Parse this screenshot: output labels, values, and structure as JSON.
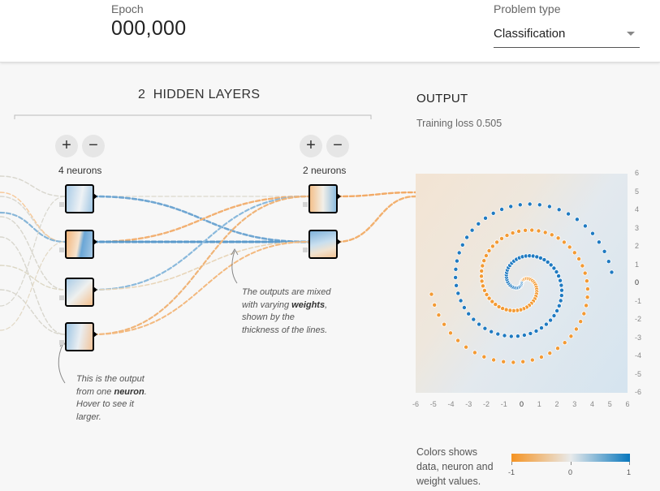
{
  "header": {
    "epoch_label": "Epoch",
    "epoch_value": "000,000",
    "problem_type_label": "Problem type",
    "problem_type_value": "Classification"
  },
  "layers": {
    "count": "2",
    "title": "HIDDEN LAYERS",
    "columns": [
      {
        "add": "+",
        "remove": "−",
        "neurons_label": "4 neurons"
      },
      {
        "add": "+",
        "remove": "−",
        "neurons_label": "2 neurons"
      }
    ]
  },
  "notes": {
    "neuron_note": {
      "pre": "This is the output from one ",
      "bold": "neuron",
      "post": ". Hover to see it larger."
    },
    "weights_note": {
      "pre": "The outputs are mixed with varying ",
      "bold": "weights",
      "post": ", shown by the thickness of the lines."
    }
  },
  "output": {
    "title": "OUTPUT",
    "training_loss_label": "Training loss",
    "training_loss_value": "0.505",
    "y_ticks": [
      "6",
      "5",
      "4",
      "3",
      "2",
      "1",
      "0",
      "-1",
      "-2",
      "-3",
      "-4",
      "-5",
      "-6"
    ],
    "x_ticks": [
      "-6",
      "-5",
      "-4",
      "-3",
      "-2",
      "-1",
      "0",
      "1",
      "2",
      "3",
      "4",
      "5",
      "6"
    ]
  },
  "legend": {
    "text": [
      "Colors shows",
      "data, neuron and",
      "weight values."
    ],
    "ticks": [
      "-1",
      "0",
      "1"
    ],
    "colors": {
      "negative": "#f59322",
      "neutral": "#e8eaeb",
      "positive": "#0877bd"
    }
  }
}
